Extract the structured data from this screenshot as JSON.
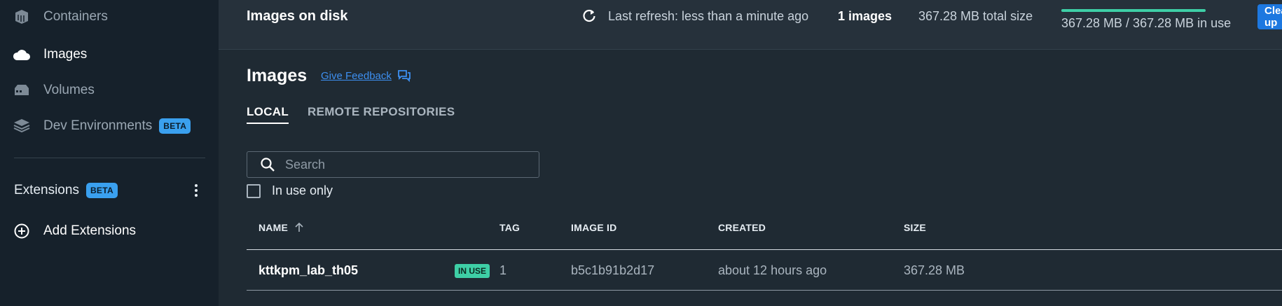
{
  "sidebar": {
    "items": [
      {
        "label": "Containers",
        "icon": "containers-icon",
        "active": false
      },
      {
        "label": "Images",
        "icon": "cloud-icon",
        "active": true
      },
      {
        "label": "Volumes",
        "icon": "volume-icon",
        "active": false
      },
      {
        "label": "Dev Environments",
        "icon": "dev-environments-icon",
        "active": false,
        "badge": "BETA"
      }
    ],
    "extensions": {
      "label": "Extensions",
      "badge": "BETA"
    },
    "add_extensions": {
      "label": "Add Extensions"
    }
  },
  "topbar": {
    "title": "Images on disk",
    "refresh_text": "Last refresh: less than a minute ago",
    "image_count": "1 images",
    "total_size": "367.28 MB total size",
    "usage_text": "367.28 MB / 367.28 MB in use",
    "usage_fraction": 1.0,
    "clean_button": "Clean up"
  },
  "main": {
    "heading": "Images",
    "feedback_link": "Give Feedback",
    "tabs": [
      {
        "label": "LOCAL",
        "active": true
      },
      {
        "label": "REMOTE REPOSITORIES",
        "active": false
      }
    ],
    "search_placeholder": "Search",
    "in_use_only_label": "In use only",
    "in_use_only_checked": false
  },
  "table": {
    "columns": [
      "NAME",
      "TAG",
      "IMAGE ID",
      "CREATED",
      "SIZE"
    ],
    "sort_column": "NAME",
    "sort_direction": "ascending",
    "rows": [
      {
        "name": "kttkpm_lab_th05",
        "badge": "IN USE",
        "tag": "1",
        "image_id": "b5c1b91b2d17",
        "created": "about 12 hours ago",
        "size": "367.28 MB"
      }
    ]
  },
  "colors": {
    "sidebar_bg": "#16212b",
    "main_bg": "#1f2a33",
    "accent": "#1d78e0",
    "beta_badge": "#3aa0ef",
    "in_use_badge": "#3ecfa6",
    "link": "#3d8ff0"
  }
}
